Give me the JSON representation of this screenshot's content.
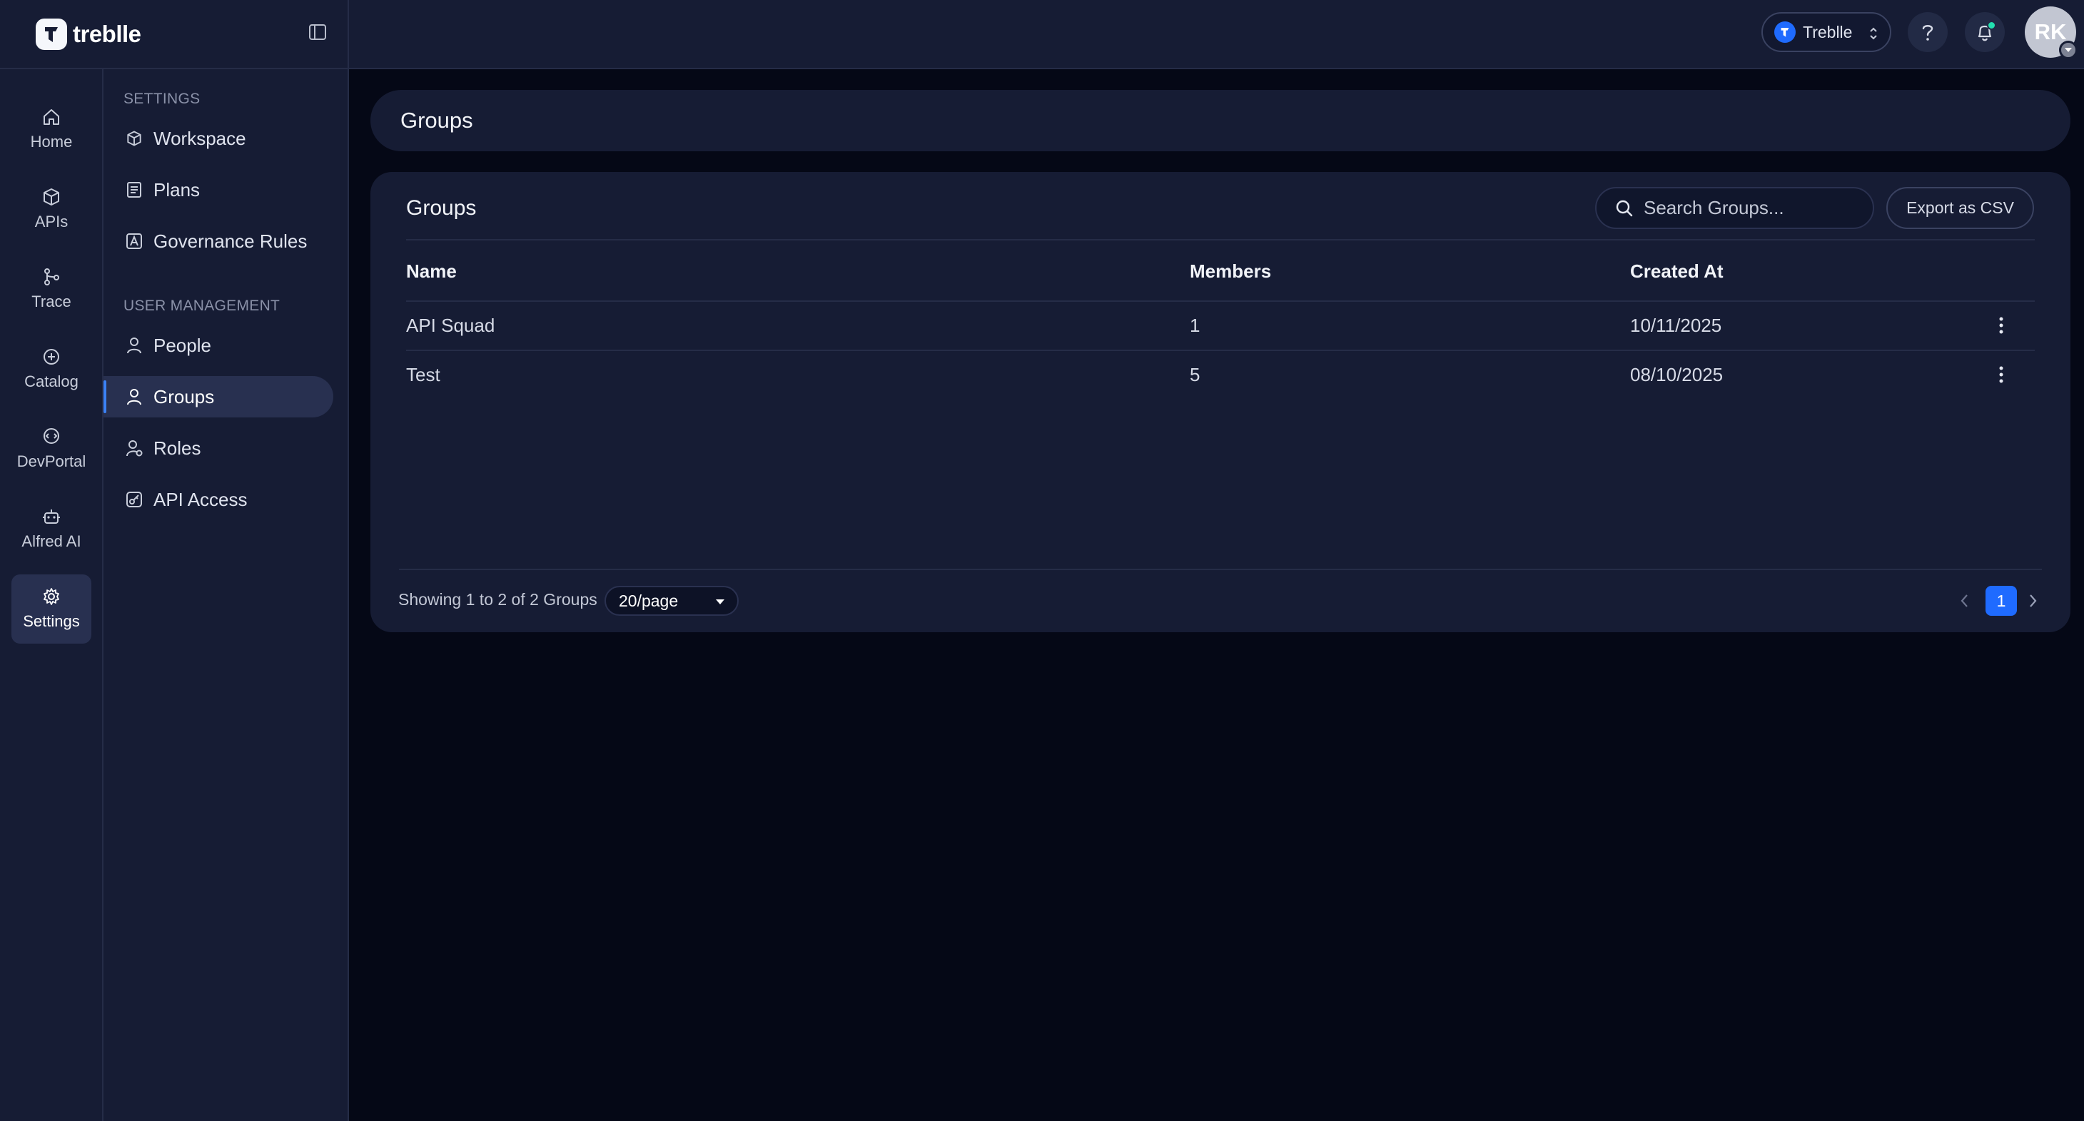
{
  "brand": {
    "name": "treblle"
  },
  "topbar": {
    "workspace_name": "Treblle",
    "avatar_initials": "RK",
    "icons": [
      "help-icon",
      "bell-icon"
    ]
  },
  "rail": {
    "items": [
      {
        "label": "Home",
        "icon": "home-icon"
      },
      {
        "label": "APIs",
        "icon": "cube-icon"
      },
      {
        "label": "Trace",
        "icon": "branch-icon"
      },
      {
        "label": "Catalog",
        "icon": "catalog-icon"
      },
      {
        "label": "DevPortal",
        "icon": "portal-icon"
      },
      {
        "label": "Alfred AI",
        "icon": "robot-icon"
      },
      {
        "label": "Settings",
        "icon": "gear-icon"
      }
    ],
    "active": "Settings"
  },
  "subnav": {
    "settings_title": "SETTINGS",
    "settings_items": [
      {
        "label": "Workspace",
        "icon": "cube-icon"
      },
      {
        "label": "Plans",
        "icon": "document-icon"
      },
      {
        "label": "Governance Rules",
        "icon": "rules-icon"
      }
    ],
    "user_mgmt_title": "USER MANAGEMENT",
    "user_items": [
      {
        "label": "People",
        "icon": "user-icon"
      },
      {
        "label": "Groups",
        "icon": "user-icon"
      },
      {
        "label": "Roles",
        "icon": "user-role-icon"
      },
      {
        "label": "API Access",
        "icon": "key-icon"
      }
    ],
    "active": "Groups"
  },
  "page": {
    "title": "Groups"
  },
  "groups": {
    "card_title": "Groups",
    "search_placeholder": "Search Groups...",
    "export_label": "Export as CSV",
    "columns": {
      "name": "Name",
      "members": "Members",
      "created_at": "Created At"
    },
    "rows": [
      {
        "name": "API Squad",
        "members": "1",
        "created_at": "10/11/2025"
      },
      {
        "name": "Test",
        "members": "5",
        "created_at": "08/10/2025"
      }
    ],
    "showing_text": "Showing 1 to 2 of 2 Groups",
    "page_size": "20/page",
    "current_page": "1"
  },
  "colors": {
    "accent": "#1f6bff",
    "active_bg": "#283050",
    "notification_dot": "#22e0b0"
  }
}
